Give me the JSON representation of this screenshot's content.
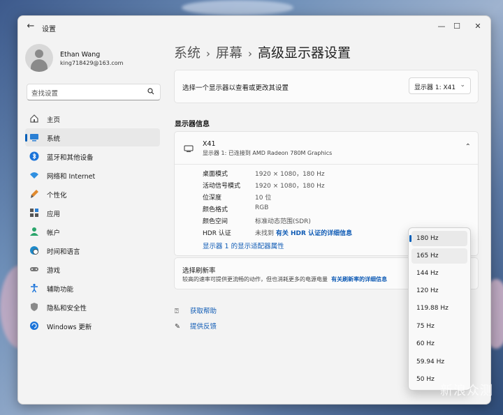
{
  "window": {
    "app_title": "设置",
    "back_icon": "back-arrow-icon",
    "controls": [
      "—",
      "☐",
      "✕"
    ]
  },
  "profile": {
    "name": "Ethan Wang",
    "email": "king718429@163.com"
  },
  "search": {
    "placeholder": "查找设置"
  },
  "sidebar": {
    "items": [
      {
        "label": "主页",
        "icon": "home-icon"
      },
      {
        "label": "系统",
        "icon": "system-icon",
        "active": true
      },
      {
        "label": "蓝牙和其他设备",
        "icon": "bluetooth-icon"
      },
      {
        "label": "网络和 Internet",
        "icon": "wifi-icon"
      },
      {
        "label": "个性化",
        "icon": "brush-icon"
      },
      {
        "label": "应用",
        "icon": "apps-icon"
      },
      {
        "label": "帐户",
        "icon": "account-icon"
      },
      {
        "label": "时间和语言",
        "icon": "globe-icon"
      },
      {
        "label": "游戏",
        "icon": "gamepad-icon"
      },
      {
        "label": "辅助功能",
        "icon": "accessibility-icon"
      },
      {
        "label": "隐私和安全性",
        "icon": "shield-icon"
      },
      {
        "label": "Windows 更新",
        "icon": "update-icon"
      }
    ]
  },
  "breadcrumb": {
    "level1": "系统",
    "level2": "屏幕",
    "current": "高级显示器设置"
  },
  "select_display": {
    "text": "选择一个显示器以查看或更改其设置",
    "dropdown_value": "显示器 1: X41"
  },
  "display_info": {
    "section_title": "显示器信息",
    "monitor_name": "X41",
    "monitor_sub": "显示器 1: 已连接到 AMD Radeon 780M Graphics",
    "rows": [
      {
        "label": "桌面模式",
        "value": "1920 × 1080，180 Hz"
      },
      {
        "label": "活动信号模式",
        "value": "1920 × 1080，180 Hz"
      },
      {
        "label": "位深度",
        "value": "10 位"
      },
      {
        "label": "颜色格式",
        "value": "RGB"
      },
      {
        "label": "颜色空间",
        "value": "标准动态范围(SDR)"
      }
    ],
    "hdr_label": "HDR 认证",
    "hdr_value": "未找到",
    "hdr_link": "有关 HDR 认证的详细信息",
    "adapter_link": "显示器 1 的显示适配器属性"
  },
  "refresh": {
    "title": "选择刷新率",
    "description": "较高的速率可提供更流畅的动作，但也消耗更多的电源电量",
    "link": "有关刷新率的详细信息"
  },
  "help": {
    "get_help": "获取帮助",
    "feedback": "提供反馈"
  },
  "refresh_options": {
    "items": [
      "180 Hz",
      "165 Hz",
      "144 Hz",
      "120 Hz",
      "119.88 Hz",
      "75 Hz",
      "60 Hz",
      "59.94 Hz",
      "50 Hz"
    ],
    "selected": "180 Hz"
  },
  "watermark": "新浪众测",
  "colors": {
    "accent": "#005fb8",
    "link": "#0f5bb5"
  }
}
